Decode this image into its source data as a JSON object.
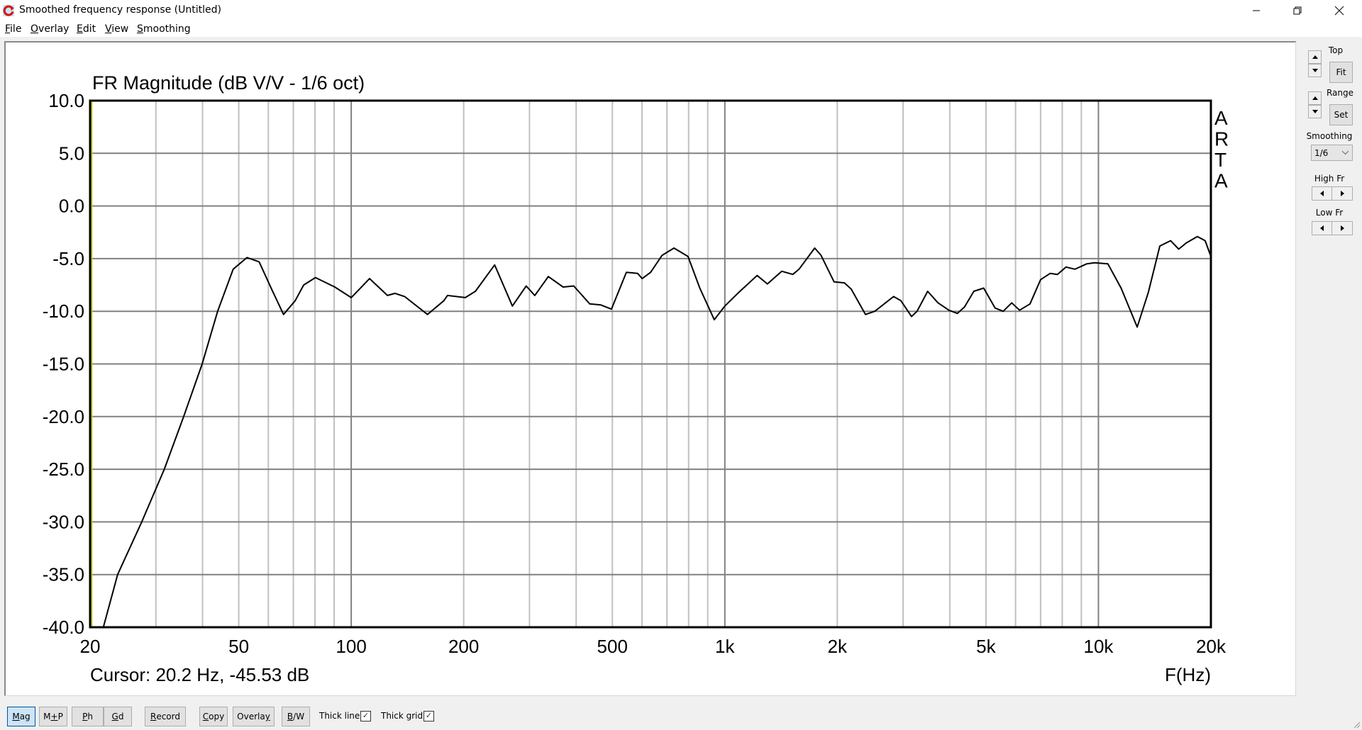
{
  "window": {
    "title": "Smoothed frequency response (Untitled)",
    "controls": [
      "minimize",
      "restore",
      "close"
    ]
  },
  "menu": {
    "items": [
      {
        "label": "File",
        "accel": "F",
        "rest": "ile"
      },
      {
        "label": "Overlay",
        "accel": "O",
        "rest": "verlay"
      },
      {
        "label": "Edit",
        "accel": "E",
        "rest": "dit"
      },
      {
        "label": "View",
        "accel": "V",
        "rest": "iew"
      },
      {
        "label": "Smoothing",
        "accel": "S",
        "rest": "moothing"
      }
    ]
  },
  "plot": {
    "watermark": [
      "A",
      "R",
      "T",
      "A"
    ],
    "cursor_readout": "Cursor: 20.2 Hz, -45.53 dB",
    "cursor_freq_hz": 20.2,
    "colors": {
      "curve": "#000000",
      "cursor": "#c8c800",
      "major_grid": "#808080",
      "minor_grid": "#c0c0c0",
      "frame": "#000000"
    }
  },
  "sidebar": {
    "top_label": "Top",
    "fit_label": "Fit",
    "range_label": "Range",
    "set_label": "Set",
    "smoothing_label": "Smoothing",
    "smoothing_value": "1/6",
    "high_fr_label": "High Fr",
    "low_fr_label": "Low Fr"
  },
  "toolbar": {
    "buttons": [
      {
        "id": "mag",
        "label": "Mag",
        "accel": "M",
        "rest": "ag",
        "active": true
      },
      {
        "id": "mp",
        "label": "M+P",
        "pre": "M",
        "accel": "+",
        "rest": "P",
        "active": false
      },
      {
        "id": "ph",
        "label": "Ph",
        "accel": "P",
        "rest": "h",
        "active": false
      },
      {
        "id": "gd",
        "label": "Gd",
        "accel": "G",
        "rest": "d",
        "active": false
      },
      {
        "id": "record",
        "label": "Record",
        "accel": "R",
        "rest": "ecord",
        "active": false
      },
      {
        "id": "copy",
        "label": "Copy",
        "accel": "C",
        "rest": "opy",
        "active": false
      },
      {
        "id": "overlay",
        "label": "Overlay",
        "pre": "Overla",
        "accel": "y",
        "rest": "",
        "active": false
      },
      {
        "id": "bw",
        "label": "B/W",
        "accel": "B",
        "rest": "/W",
        "active": false
      }
    ],
    "thick_line_label": "Thick line",
    "thick_line_checked": true,
    "thick_grid_label": "Thick grid",
    "thick_grid_checked": true
  },
  "chart_data": {
    "type": "line",
    "title": "FR Magnitude (dB V/V - 1/6 oct)",
    "xlabel": "F(Hz)",
    "ylabel": "",
    "xscale": "log",
    "xlim": [
      20,
      20000
    ],
    "ylim": [
      -40,
      10
    ],
    "grid": true,
    "xticks": [
      {
        "value": 20,
        "label": "20"
      },
      {
        "value": 50,
        "label": "50"
      },
      {
        "value": 100,
        "label": "100"
      },
      {
        "value": 200,
        "label": "200"
      },
      {
        "value": 500,
        "label": "500"
      },
      {
        "value": 1000,
        "label": "1k"
      },
      {
        "value": 2000,
        "label": "2k"
      },
      {
        "value": 5000,
        "label": "5k"
      },
      {
        "value": 10000,
        "label": "10k"
      },
      {
        "value": 20000,
        "label": "20k"
      }
    ],
    "yticks": [
      {
        "value": 10,
        "label": "10.0"
      },
      {
        "value": 5,
        "label": "5.0"
      },
      {
        "value": 0,
        "label": "0.0"
      },
      {
        "value": -5,
        "label": "-5.0"
      },
      {
        "value": -10,
        "label": "-10.0"
      },
      {
        "value": -15,
        "label": "-15.0"
      },
      {
        "value": -20,
        "label": "-20.0"
      },
      {
        "value": -25,
        "label": "-25.0"
      },
      {
        "value": -30,
        "label": "-30.0"
      },
      {
        "value": -35,
        "label": "-35.0"
      },
      {
        "value": -40,
        "label": "-40.0"
      }
    ],
    "series": [
      {
        "name": "FR Magnitude",
        "x": [
          21.7,
          23.7,
          27.5,
          31.6,
          35.6,
          39.9,
          43.9,
          48.3,
          52.6,
          56.7,
          61.4,
          65.9,
          70.8,
          74.6,
          80.2,
          90.4,
          100,
          112,
          125,
          131,
          139,
          160,
          177,
          181,
          202,
          215,
          242,
          270,
          294,
          310,
          337,
          369,
          394,
          435,
          466,
          497,
          545,
          584,
          601,
          633,
          679,
          731,
          797,
          857,
          937,
          1000,
          1090,
          1220,
          1300,
          1420,
          1520,
          1580,
          1740,
          1810,
          1960,
          2090,
          2180,
          2380,
          2520,
          2830,
          2960,
          3160,
          3270,
          3490,
          3720,
          3980,
          4190,
          4380,
          4640,
          4930,
          5290,
          5560,
          5860,
          6150,
          6560,
          7000,
          7430,
          7770,
          8190,
          8650,
          9300,
          9770,
          10600,
          11500,
          12700,
          13600,
          14600,
          15600,
          16400,
          17200,
          18400,
          19300,
          20000
        ],
        "y": [
          -40.0,
          -35.0,
          -30.0,
          -25.0,
          -20.0,
          -15.0,
          -10.0,
          -6.0,
          -4.9,
          -5.3,
          -8.0,
          -10.3,
          -9.0,
          -7.5,
          -6.8,
          -7.7,
          -8.7,
          -6.9,
          -8.5,
          -8.3,
          -8.6,
          -10.3,
          -9.0,
          -8.5,
          -8.7,
          -8.1,
          -5.6,
          -9.5,
          -7.6,
          -8.5,
          -6.7,
          -7.7,
          -7.6,
          -9.3,
          -9.4,
          -9.8,
          -6.3,
          -6.4,
          -6.9,
          -6.3,
          -4.7,
          -4.0,
          -4.8,
          -7.8,
          -10.8,
          -9.5,
          -8.2,
          -6.6,
          -7.4,
          -6.2,
          -6.5,
          -6.0,
          -4.0,
          -4.7,
          -7.2,
          -7.3,
          -7.9,
          -10.3,
          -10.0,
          -8.6,
          -9.0,
          -10.5,
          -10.0,
          -8.1,
          -9.2,
          -9.9,
          -10.2,
          -9.6,
          -8.1,
          -7.8,
          -9.7,
          -10.0,
          -9.2,
          -9.9,
          -9.3,
          -7.0,
          -6.4,
          -6.5,
          -5.8,
          -6.0,
          -5.5,
          -5.4,
          -5.5,
          -7.8,
          -11.5,
          -8.2,
          -3.8,
          -3.3,
          -4.1,
          -3.5,
          -2.9,
          -3.3,
          -4.8
        ]
      }
    ]
  }
}
